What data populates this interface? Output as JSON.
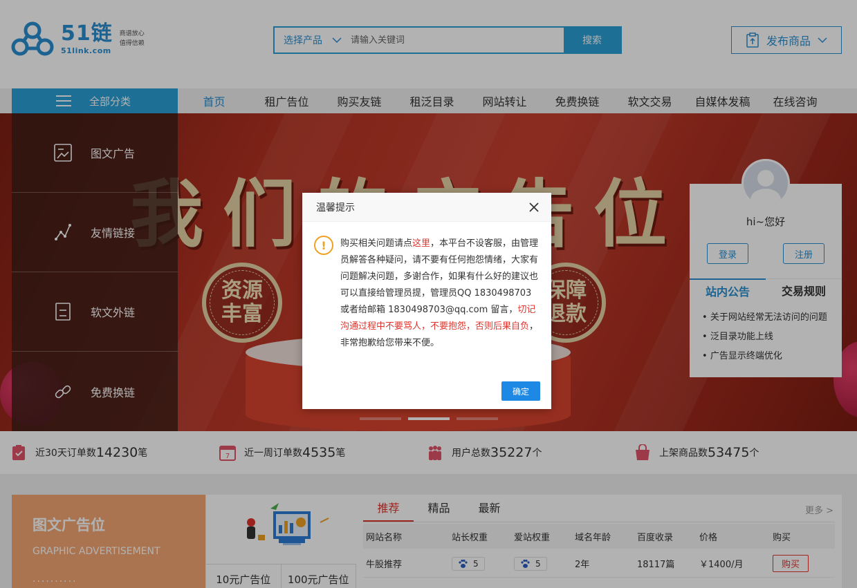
{
  "header": {
    "logo_main": "51链",
    "logo_sub": "51link.com",
    "slogan_line1": "商谱放心",
    "slogan_line2": "值得信赖",
    "search_select": "选择产品",
    "search_placeholder": "请输入关键词",
    "search_button": "搜索",
    "publish_button": "发布商品"
  },
  "nav": {
    "all_categories": "全部分类",
    "items": [
      "首页",
      "租广告位",
      "购买友链",
      "租泛目录",
      "网站转让",
      "免费换链",
      "软文交易",
      "自媒体发稿",
      "在线咨询"
    ]
  },
  "categories": [
    "图文广告",
    "友情链接",
    "软文外链",
    "免费换链"
  ],
  "banner": {
    "title": "我们的广告位",
    "badge_left": [
      "资源",
      "丰富"
    ],
    "badge_right": [
      "保障",
      "退款"
    ]
  },
  "user_card": {
    "greeting": "hi~您好",
    "login": "登录",
    "register": "注册",
    "tab_notice": "站内公告",
    "tab_rules": "交易规则",
    "notices": [
      "关于网站经常无法访问的问题",
      "泛目录功能上线",
      "广告显示终端优化"
    ]
  },
  "stats": [
    {
      "label": "近30天订单数",
      "value": "14230",
      "unit": "笔",
      "icon": "order-check-icon"
    },
    {
      "label": "近一周订单数",
      "value": "4535",
      "unit": "笔",
      "icon": "calendar-icon"
    },
    {
      "label": "用户总数",
      "value": "35227",
      "unit": "个",
      "icon": "users-icon"
    },
    {
      "label": "上架商品数",
      "value": "53475",
      "unit": "个",
      "icon": "shopping-bag-icon"
    }
  ],
  "graphic_ad": {
    "title": "图文广告位",
    "subtitle": "GRAPHIC ADVERTISEMENT",
    "divider": "..........",
    "price_tab_1": "10元广告位",
    "price_tab_2": "100元广告位"
  },
  "listing": {
    "tabs": [
      "推荐",
      "精品",
      "最新"
    ],
    "more": "更多 >",
    "columns": [
      "网站名称",
      "站长权重",
      "爱站权重",
      "域名年龄",
      "百度收录",
      "价格",
      "购买"
    ],
    "rows": [
      {
        "name": "牛股推荐",
        "weight1": "5",
        "weight2": "5",
        "age": "2年",
        "indexed": "18117篇",
        "price": "￥1400/月",
        "buy": "购买"
      }
    ]
  },
  "modal": {
    "title": "温馨提示",
    "text_1": "购买相关问题请点",
    "link": "这里",
    "text_2": "，本平台不设客服，由管理员解答各种疑问，请不要有任何抱怨情绪，大家有问题解决问题，多谢合作，如果有什么好的建议也可以直接给管理员提，管理员QQ 1830498703 或者给邮箱 1830498703@qq.com 留言，",
    "warning": "切记沟通过程中不要骂人，不要抱怨，否则后果自负",
    "text_3": "，非常抱歉给您带来不便。",
    "confirm": "确定"
  },
  "colors": {
    "accent": "#2a9fd6",
    "red": "#e0342c",
    "banner": "#b63323"
  }
}
